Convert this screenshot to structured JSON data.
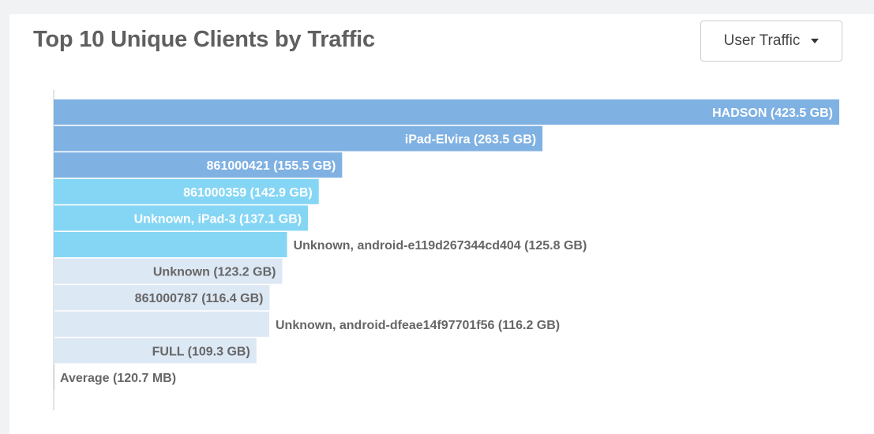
{
  "header": {
    "title": "Top 10 Unique Clients by Traffic"
  },
  "dropdown": {
    "selected": "User Traffic",
    "icon": "caret-down-icon"
  },
  "colors": {
    "bar_dark_blue": "#7fb1e3",
    "bar_light_blue": "#85d6f5",
    "bar_pale": "#dde8f5",
    "label_on_bar": "#ffffff",
    "label_outside": "#666666",
    "axis": "#c8c8c8"
  },
  "chart_data": {
    "type": "bar",
    "orientation": "horizontal",
    "title": "Top 10 Unique Clients by Traffic",
    "unit": "GB",
    "categories": [
      "HADSON",
      "iPad-Elvira",
      "861000421",
      "861000359",
      "Unknown, iPad-3",
      "Unknown, android-e119d267344cd404",
      "Unknown",
      "861000787",
      "Unknown, android-dfeae14f97701f56",
      "FULL"
    ],
    "values": [
      423.5,
      263.5,
      155.5,
      142.9,
      137.1,
      125.8,
      123.2,
      116.4,
      116.2,
      109.3
    ],
    "labels": [
      "HADSON (423.5 GB)",
      "iPad-Elvira (263.5 GB)",
      "861000421 (155.5 GB)",
      "861000359 (142.9 GB)",
      "Unknown, iPad-3 (137.1 GB)",
      "Unknown, android-e119d267344cd404 (125.8 GB)",
      "Unknown (123.2 GB)",
      "861000787 (116.4 GB)",
      "Unknown, android-dfeae14f97701f56 (116.2 GB)",
      "FULL (109.3 GB)"
    ],
    "bar_colors": [
      "#7fb1e3",
      "#7fb1e3",
      "#7fb1e3",
      "#85d6f5",
      "#85d6f5",
      "#85d6f5",
      "#dde8f5",
      "#dde8f5",
      "#dde8f5",
      "#dde8f5"
    ],
    "average": {
      "label": "Average (120.7 MB)",
      "value_gb": 0.1207
    },
    "xlim": [
      0,
      423.5
    ],
    "grid": false,
    "legend": "none"
  }
}
